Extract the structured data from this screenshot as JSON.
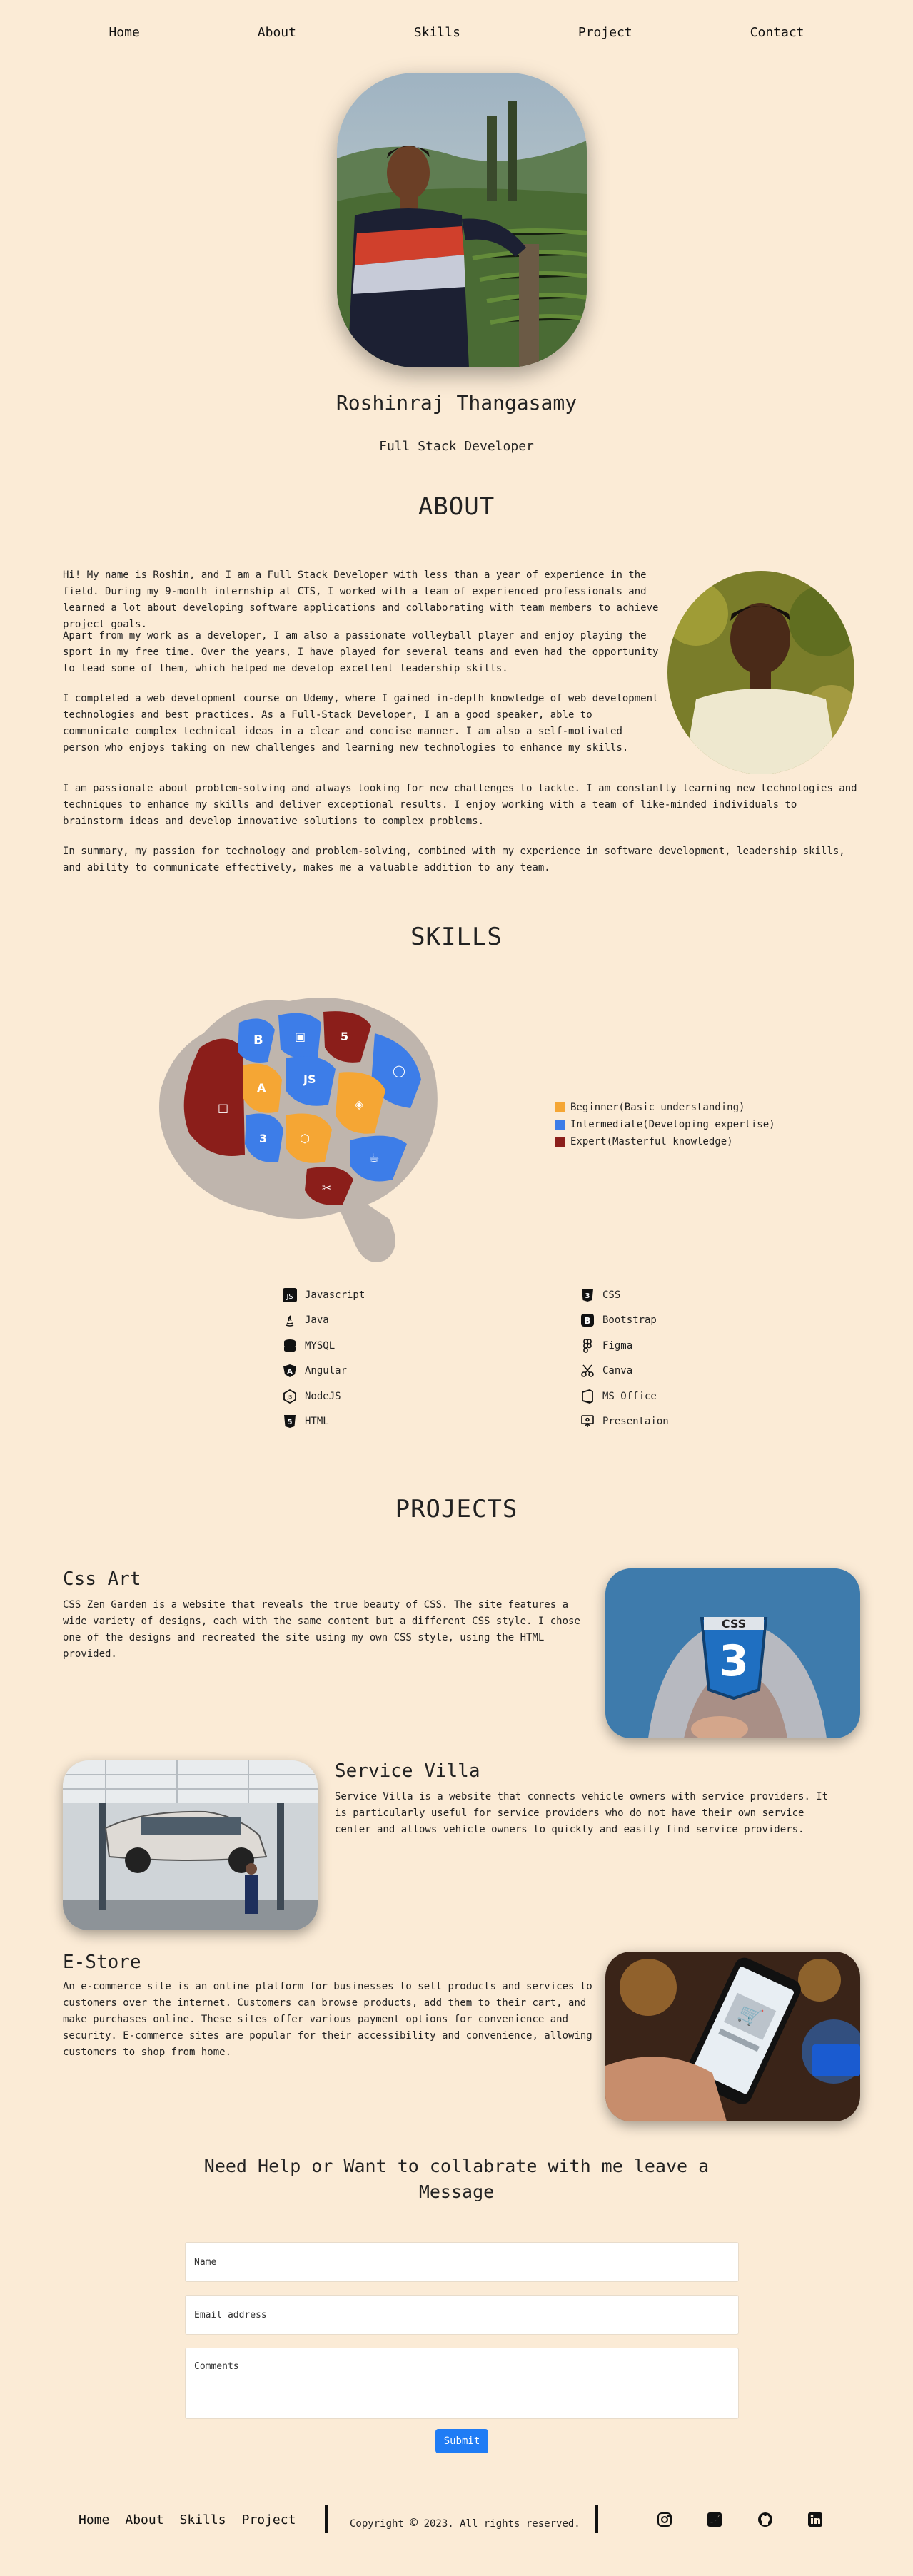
{
  "nav": [
    "Home",
    "About",
    "Skills",
    "Project",
    "Contact"
  ],
  "hero": {
    "name": "Roshinraj Thangasamy",
    "role": "Full Stack Developer"
  },
  "about": {
    "title": "ABOUT",
    "paragraphs": [
      "Hi! My name is Roshin, and I am a Full Stack Developer with less than a year of experience in the field. During my 9-month internship at CTS, I worked with a team of experienced professionals and learned a lot about developing software applications and collaborating with team members to achieve project goals.",
      "Apart from my work as a developer, I am also a passionate volleyball player and enjoy playing the sport in my free time. Over the years, I have played for several teams and even had the opportunity to lead some of them, which helped me develop excellent leadership skills.",
      "I completed a web development course on Udemy, where I gained in-depth knowledge of web development technologies and best practices. As a Full-Stack Developer, I am a good speaker, able to communicate complex technical ideas in a clear and concise manner. I am also a self-motivated person who enjoys taking on new challenges and learning new technologies to enhance my skills.",
      "I am passionate about problem-solving and always looking for new challenges to tackle. I am constantly learning new technologies and techniques to enhance my skills and deliver exceptional results. I enjoy working with a team of like-minded individuals to brainstorm ideas and develop innovative solutions to complex problems.",
      "In summary, my passion for technology and problem-solving, combined with my experience in software development, leadership skills, and ability to communicate effectively, makes me a valuable addition to any team."
    ]
  },
  "skills": {
    "title": "SKILLS",
    "legend": [
      {
        "label": "Beginner(Basic understanding)",
        "color": "#f5a634"
      },
      {
        "label": "Intermediate(Developing expertise)",
        "color": "#3d7de8"
      },
      {
        "label": "Expert(Masterful knowledge)",
        "color": "#8b1e1a"
      }
    ],
    "left": [
      {
        "name": "Javascript",
        "icon": "js-icon"
      },
      {
        "name": "Java",
        "icon": "java-icon"
      },
      {
        "name": "MYSQL",
        "icon": "database-icon"
      },
      {
        "name": "Angular",
        "icon": "angular-icon"
      },
      {
        "name": "NodeJS",
        "icon": "nodejs-icon"
      },
      {
        "name": "HTML",
        "icon": "html5-icon"
      }
    ],
    "right": [
      {
        "name": "CSS",
        "icon": "css3-icon"
      },
      {
        "name": "Bootstrap",
        "icon": "bootstrap-icon"
      },
      {
        "name": "Figma",
        "icon": "figma-icon"
      },
      {
        "name": "Canva",
        "icon": "scissors-icon"
      },
      {
        "name": "MS Office",
        "icon": "office-icon"
      },
      {
        "name": "Presentaion",
        "icon": "presentation-icon"
      }
    ]
  },
  "projects": {
    "title": "PROJECTS",
    "items": [
      {
        "title": "Css Art",
        "desc": "CSS Zen Garden is a website that reveals the true beauty of CSS. The site features a wide variety of designs, each with the same content but a different CSS style. I chose one of the designs and recreated the site using my own CSS style, using the HTML provided."
      },
      {
        "title": "Service Villa",
        "desc": "Service Villa is a website that connects vehicle owners with service providers. It is particularly useful for service providers who do not have their own service center and allows vehicle owners to quickly and easily find service providers."
      },
      {
        "title": "E-Store",
        "desc": "An e-commerce site is an online platform for businesses to sell products and services to customers over the internet. Customers can browse products, add them to their cart, and make purchases online. These sites offer various payment options for convenience and security. E-commerce sites are popular for their accessibility and convenience, allowing customers to shop from home."
      }
    ]
  },
  "contact": {
    "heading_line1": "Need Help or Want to collabrate with me leave a",
    "heading_line2": "Message",
    "name_placeholder": "Name",
    "email_placeholder": "Email address",
    "comments_placeholder": "Comments",
    "submit": "Submit"
  },
  "footer": {
    "links": [
      "Home",
      "About",
      "Skills",
      "Project"
    ],
    "copyright_pre": "Copyright",
    "copyright_post": "2023. All rights reserved.",
    "social": [
      "instagram-icon",
      "twitter-icon",
      "github-icon",
      "linkedin-icon"
    ]
  }
}
